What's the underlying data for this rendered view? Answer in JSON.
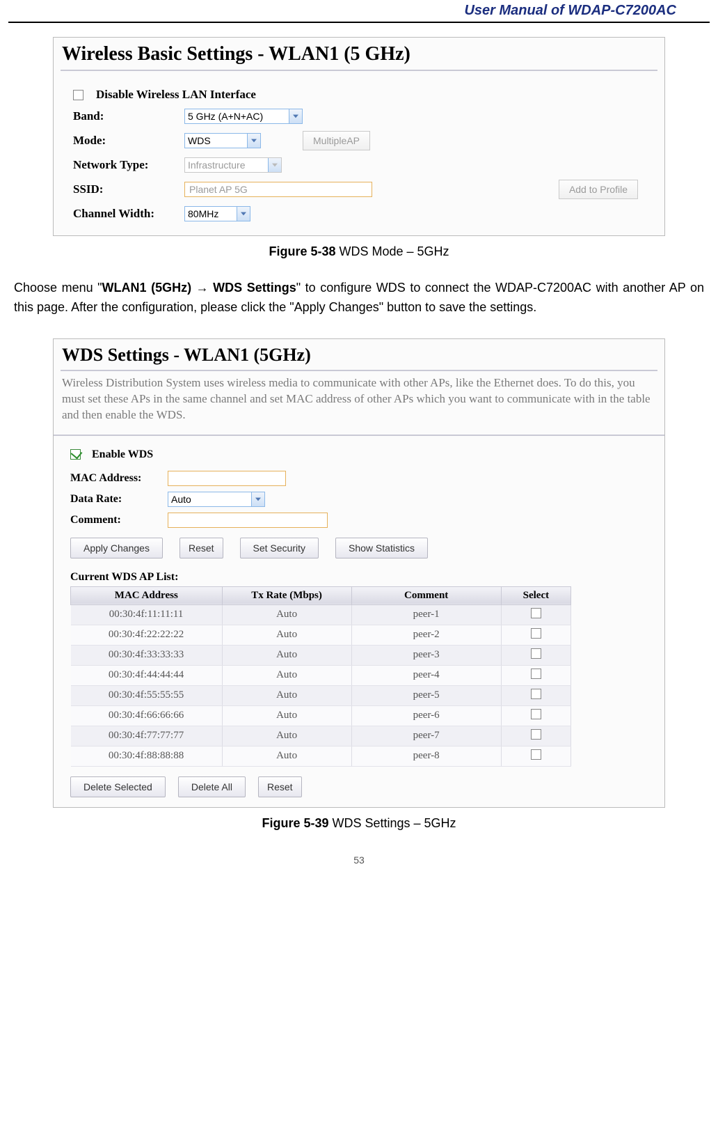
{
  "header": "User Manual of WDAP-C7200AC",
  "fig1": {
    "title": "Wireless Basic Settings - WLAN1 (5 GHz)",
    "disable_label": "Disable Wireless LAN Interface",
    "rows": {
      "band_label": "Band:",
      "band_value": "5 GHz (A+N+AC)",
      "mode_label": "Mode:",
      "mode_value": "WDS",
      "multiple_ap": "MultipleAP",
      "net_label": "Network Type:",
      "net_value": "Infrastructure",
      "ssid_label": "SSID:",
      "ssid_value": "Planet AP 5G",
      "add_profile": "Add to Profile",
      "ch_label": "Channel Width:",
      "ch_value": "80MHz"
    }
  },
  "caption1_bold": "Figure 5-38",
  "caption1_rest": " WDS Mode – 5GHz",
  "para": {
    "pre": "Choose menu \"",
    "bold": "WLAN1 (5GHz) ",
    "arrow_bold": " WDS Settings",
    "post": "\" to configure WDS to connect the WDAP-C7200AC with another AP on this page. After the configuration, please click the \"Apply Changes\" button to save the settings."
  },
  "fig2": {
    "title": "WDS Settings - WLAN1 (5GHz)",
    "desc": "Wireless Distribution System uses wireless media to communicate with other APs, like the Ethernet does. To do this, you must set these APs in the same channel and set MAC address of other APs which you want to communicate with in the table and then enable the WDS.",
    "enable": "Enable WDS",
    "mac_label": "MAC Address:",
    "rate_label": "Data Rate:",
    "rate_value": "Auto",
    "comment_label": "Comment:",
    "btns": {
      "apply": "Apply Changes",
      "reset": "Reset",
      "sec": "Set Security",
      "stats": "Show Statistics"
    },
    "list_head": "Current WDS AP List:",
    "cols": {
      "mac": "MAC Address",
      "rate": "Tx Rate (Mbps)",
      "comment": "Comment",
      "sel": "Select"
    },
    "rows": [
      {
        "mac": "00:30:4f:11:11:11",
        "rate": "Auto",
        "comment": "peer-1"
      },
      {
        "mac": "00:30:4f:22:22:22",
        "rate": "Auto",
        "comment": "peer-2"
      },
      {
        "mac": "00:30:4f:33:33:33",
        "rate": "Auto",
        "comment": "peer-3"
      },
      {
        "mac": "00:30:4f:44:44:44",
        "rate": "Auto",
        "comment": "peer-4"
      },
      {
        "mac": "00:30:4f:55:55:55",
        "rate": "Auto",
        "comment": "peer-5"
      },
      {
        "mac": "00:30:4f:66:66:66",
        "rate": "Auto",
        "comment": "peer-6"
      },
      {
        "mac": "00:30:4f:77:77:77",
        "rate": "Auto",
        "comment": "peer-7"
      },
      {
        "mac": "00:30:4f:88:88:88",
        "rate": "Auto",
        "comment": "peer-8"
      }
    ],
    "btns2": {
      "del": "Delete Selected",
      "delall": "Delete All",
      "reset": "Reset"
    }
  },
  "caption2_bold": "Figure 5-39",
  "caption2_rest": " WDS Settings – 5GHz",
  "page_num": "53"
}
